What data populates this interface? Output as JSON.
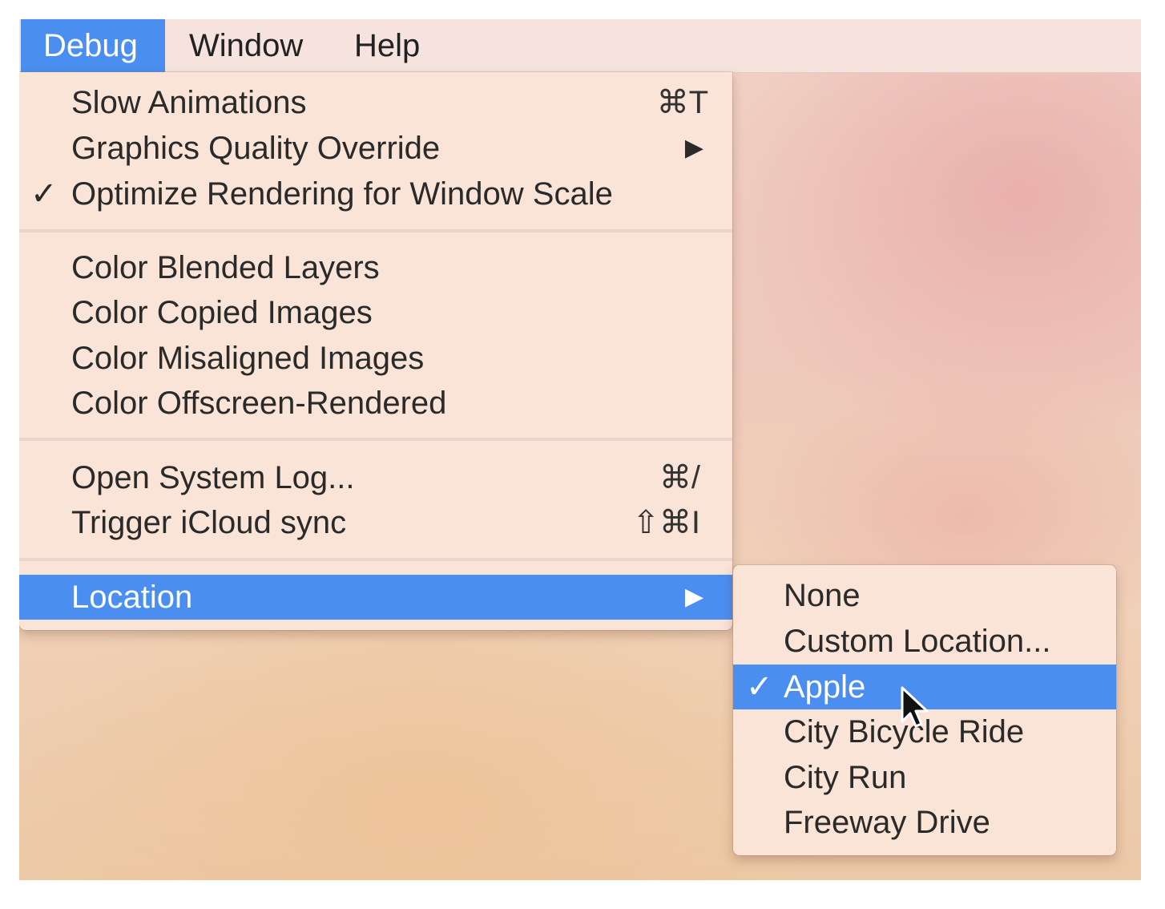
{
  "menubar": {
    "items": [
      {
        "label": "Debug",
        "active": true
      },
      {
        "label": "Window"
      },
      {
        "label": "Help"
      }
    ]
  },
  "debug_menu": {
    "slow_animations": {
      "label": "Slow Animations",
      "shortcut": "⌘T"
    },
    "graphics_quality": {
      "label": "Graphics Quality Override",
      "icon": "submenu-arrow-icon"
    },
    "optimize_rendering": {
      "label": "Optimize Rendering for Window Scale",
      "checked": true
    },
    "color_blended": {
      "label": "Color Blended Layers"
    },
    "color_copied": {
      "label": "Color Copied Images"
    },
    "color_misaligned": {
      "label": "Color Misaligned Images"
    },
    "color_offscreen": {
      "label": "Color Offscreen-Rendered"
    },
    "open_system_log": {
      "label": "Open System Log...",
      "shortcut": "⌘/"
    },
    "trigger_icloud": {
      "label": "Trigger iCloud sync",
      "shortcut": "⇧⌘I"
    },
    "location": {
      "label": "Location",
      "highlighted": true,
      "icon": "submenu-arrow-icon"
    }
  },
  "location_submenu": {
    "items": [
      {
        "label": "None"
      },
      {
        "label": "Custom Location..."
      },
      {
        "label": "Apple",
        "checked": true,
        "highlighted": true
      },
      {
        "label": "City Bicycle Ride"
      },
      {
        "label": "City Run"
      },
      {
        "label": "Freeway Drive"
      }
    ]
  },
  "symbols": {
    "check": "✓",
    "arrow": "▶"
  },
  "colors": {
    "highlight": "#4a8ff0",
    "menu_bg": "#fae4d8"
  }
}
